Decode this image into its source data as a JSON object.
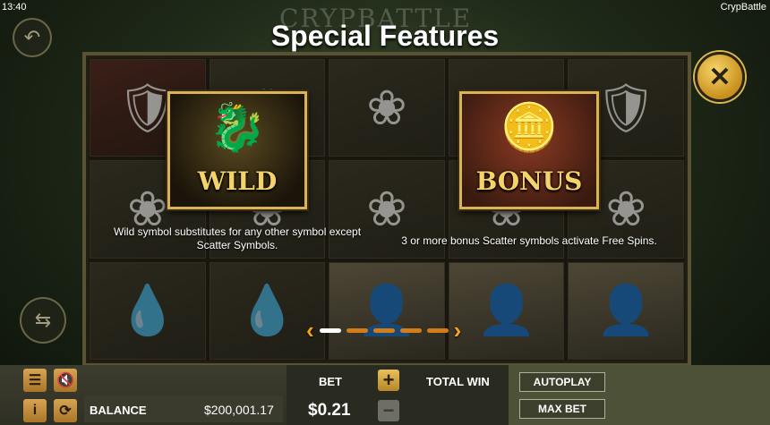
{
  "status": {
    "time": "13:40",
    "app_name": "CrypBattle"
  },
  "logo_text": "CRYPBATTLE",
  "panel": {
    "title": "Special Features",
    "features": [
      {
        "symbol_label": "WILD",
        "symbol_icon": "🐉",
        "description": "Wild symbol substitutes for any other symbol except Scatter Symbols."
      },
      {
        "symbol_label": "BONUS",
        "symbol_icon": "🪙",
        "description": "3 or more bonus Scatter symbols activate Free Spins."
      }
    ],
    "pager": {
      "prev": "‹",
      "next": "›",
      "pages": 5,
      "current": 1
    }
  },
  "reel_icons": [
    "🛡",
    "☘",
    "❀",
    "❀",
    "🛡",
    "❀",
    "❀",
    "❀",
    "❀",
    "❀",
    "💧",
    "💧",
    "👤",
    "👤",
    "👤"
  ],
  "controls": {
    "balance_label": "BALANCE",
    "balance_value": "$200,001.17",
    "bet_label": "BET",
    "bet_value": "$0.21",
    "total_win_label": "TOTAL WIN",
    "autoplay_label": "AUTOPLAY",
    "max_bet_label": "MAX BET",
    "plus_symbol": "+",
    "minus_symbol": "−"
  },
  "colors": {
    "accent": "#f2a41c",
    "gold": "#d8b456",
    "panel_border": "#5a5235"
  }
}
